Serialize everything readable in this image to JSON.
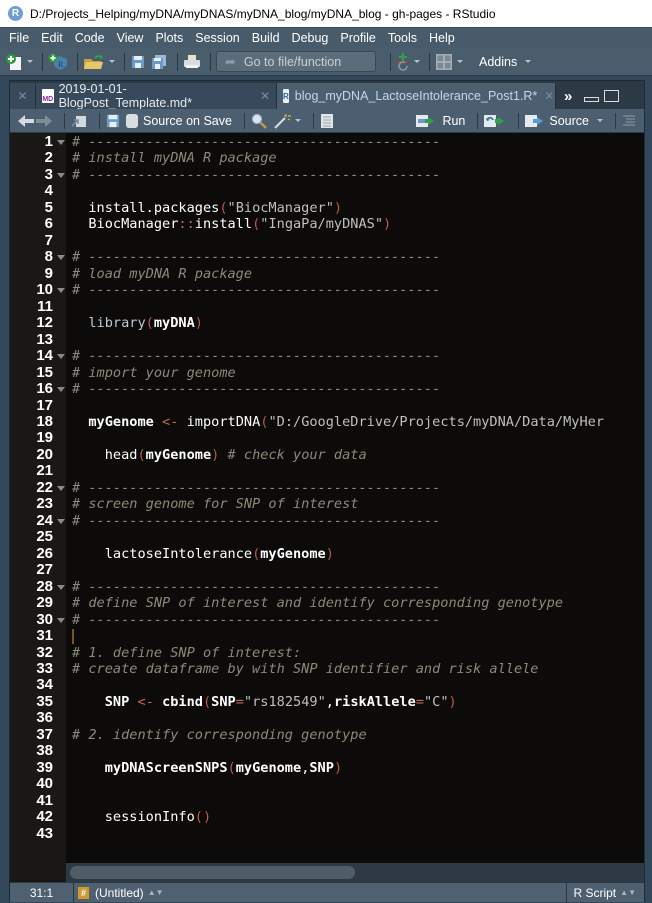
{
  "window": {
    "title": "D:/Projects_Helping/myDNA/myDNAS/myDNA_blog/myDNA_blog - gh-pages - RStudio",
    "app_icon": "R"
  },
  "menu": [
    "File",
    "Edit",
    "Code",
    "View",
    "Plots",
    "Session",
    "Build",
    "Debug",
    "Profile",
    "Tools",
    "Help"
  ],
  "toolbar": {
    "goto_placeholder": "Go to file/function",
    "addins_label": "Addins",
    "icons": [
      "new-file-icon",
      "new-project-icon",
      "open-folder-icon",
      "save-icon",
      "save-all-icon",
      "print-icon",
      "git-icon",
      "layout-grid-icon"
    ]
  },
  "tabs": [
    {
      "label": "2019-01-01-BlogPost_Template.md*",
      "icon": "MD",
      "active": false
    },
    {
      "label": "blog_myDNA_LactoseIntolerance_Post1.R*",
      "icon": "R",
      "active": true
    }
  ],
  "editor_toolbar": {
    "source_on_save": "Source on Save",
    "run_label": "Run",
    "source_label": "Source"
  },
  "code_lines": [
    {
      "n": 1,
      "fold": true,
      "html": "<span class='c-comment'># -------------------------------------------</span>"
    },
    {
      "n": 2,
      "fold": false,
      "html": "<span class='c-comment'># install myDNA R package</span>"
    },
    {
      "n": 3,
      "fold": true,
      "html": "<span class='c-comment'># -------------------------------------------</span>"
    },
    {
      "n": 4,
      "fold": false,
      "html": ""
    },
    {
      "n": 5,
      "fold": false,
      "html": "  install.packages<span class='c-paren'>(</span><span class='c-str'>\"BiocManager\"</span><span class='c-paren'>)</span>"
    },
    {
      "n": 6,
      "fold": false,
      "html": "  BiocManager<span class='c-op'>::</span>install<span class='c-paren'>(</span><span class='c-str'>\"IngaPa/myDNAS\"</span><span class='c-paren'>)</span>"
    },
    {
      "n": 7,
      "fold": false,
      "html": ""
    },
    {
      "n": 8,
      "fold": true,
      "html": "<span class='c-comment'># -------------------------------------------</span>"
    },
    {
      "n": 9,
      "fold": false,
      "html": "<span class='c-comment'># load myDNA R package</span>"
    },
    {
      "n": 10,
      "fold": true,
      "html": "<span class='c-comment'># -------------------------------------------</span>"
    },
    {
      "n": 11,
      "fold": false,
      "html": ""
    },
    {
      "n": 12,
      "fold": false,
      "html": "  <span class='c-kw'>library</span><span class='c-paren'>(</span><span class='c-arg'>myDNA</span><span class='c-paren'>)</span>"
    },
    {
      "n": 13,
      "fold": false,
      "html": ""
    },
    {
      "n": 14,
      "fold": true,
      "html": "<span class='c-comment'># -------------------------------------------</span>"
    },
    {
      "n": 15,
      "fold": false,
      "html": "<span class='c-comment'># import your genome</span>"
    },
    {
      "n": 16,
      "fold": true,
      "html": "<span class='c-comment'># -------------------------------------------</span>"
    },
    {
      "n": 17,
      "fold": false,
      "html": ""
    },
    {
      "n": 18,
      "fold": false,
      "html": "  <span class='c-arg'>myGenome</span> <span class='c-op'>&lt;-</span> importDNA<span class='c-paren'>(</span><span class='c-str'>\"D:/GoogleDrive/Projects/myDNA/Data/MyHer</span>"
    },
    {
      "n": 19,
      "fold": false,
      "html": ""
    },
    {
      "n": 20,
      "fold": false,
      "html": "    head<span class='c-paren'>(</span><span class='c-arg'>myGenome</span><span class='c-paren'>)</span> <span class='c-comment'># check your data</span>"
    },
    {
      "n": 21,
      "fold": false,
      "html": ""
    },
    {
      "n": 22,
      "fold": true,
      "html": "<span class='c-comment'># -------------------------------------------</span>"
    },
    {
      "n": 23,
      "fold": false,
      "html": "<span class='c-comment'># screen genome for SNP of interest</span>"
    },
    {
      "n": 24,
      "fold": true,
      "html": "<span class='c-comment'># -------------------------------------------</span>"
    },
    {
      "n": 25,
      "fold": false,
      "html": ""
    },
    {
      "n": 26,
      "fold": false,
      "html": "    lactoseIntolerance<span class='c-paren'>(</span><span class='c-arg'>myGenome</span><span class='c-paren'>)</span>"
    },
    {
      "n": 27,
      "fold": false,
      "html": ""
    },
    {
      "n": 28,
      "fold": true,
      "html": "<span class='c-comment'># -------------------------------------------</span>"
    },
    {
      "n": 29,
      "fold": false,
      "html": "<span class='c-comment'># define SNP of interest and identify corresponding genotype</span>"
    },
    {
      "n": 30,
      "fold": true,
      "html": "<span class='c-comment'># -------------------------------------------</span>"
    },
    {
      "n": 31,
      "fold": false,
      "html": "<span class='cursor'></span>"
    },
    {
      "n": 32,
      "fold": false,
      "html": "<span class='c-comment'># 1. define SNP of interest:</span>"
    },
    {
      "n": 33,
      "fold": false,
      "html": "<span class='c-comment'># create dataframe by with SNP identifier and risk allele</span>"
    },
    {
      "n": 34,
      "fold": false,
      "html": ""
    },
    {
      "n": 35,
      "fold": false,
      "html": "    <span class='c-arg'>SNP</span> <span class='c-op'>&lt;-</span> <span class='c-arg'>cbind</span><span class='c-paren'>(</span><span class='c-arg'>SNP</span><span class='c-op'>=</span><span class='c-str'>\"rs182549\"</span>,<span class='c-arg'>riskAllele</span><span class='c-op'>=</span><span class='c-str'>\"C\"</span><span class='c-paren'>)</span>"
    },
    {
      "n": 36,
      "fold": false,
      "html": ""
    },
    {
      "n": 37,
      "fold": false,
      "html": "<span class='c-comment'># 2. identify corresponding genotype</span>"
    },
    {
      "n": 38,
      "fold": false,
      "html": ""
    },
    {
      "n": 39,
      "fold": false,
      "html": "    <span class='c-arg'>myDNAScreenSNPS</span><span class='c-paren'>(</span><span class='c-arg'>myGenome</span>,<span class='c-arg'>SNP</span><span class='c-paren'>)</span>"
    },
    {
      "n": 40,
      "fold": false,
      "html": ""
    },
    {
      "n": 41,
      "fold": false,
      "html": ""
    },
    {
      "n": 42,
      "fold": false,
      "html": "    sessionInfo<span class='c-paren'>()</span>"
    },
    {
      "n": 43,
      "fold": false,
      "html": ""
    }
  ],
  "status": {
    "cursor_position": "31:1",
    "scope_badge": "#",
    "scope": "(Untitled)",
    "file_type": "R Script"
  },
  "colors": {
    "code_background": "#0c0b09",
    "gutter_background": "#1a1815",
    "comment": "#8a8a7a",
    "paren": "#b85a4a",
    "chrome": "#4b5f70"
  }
}
